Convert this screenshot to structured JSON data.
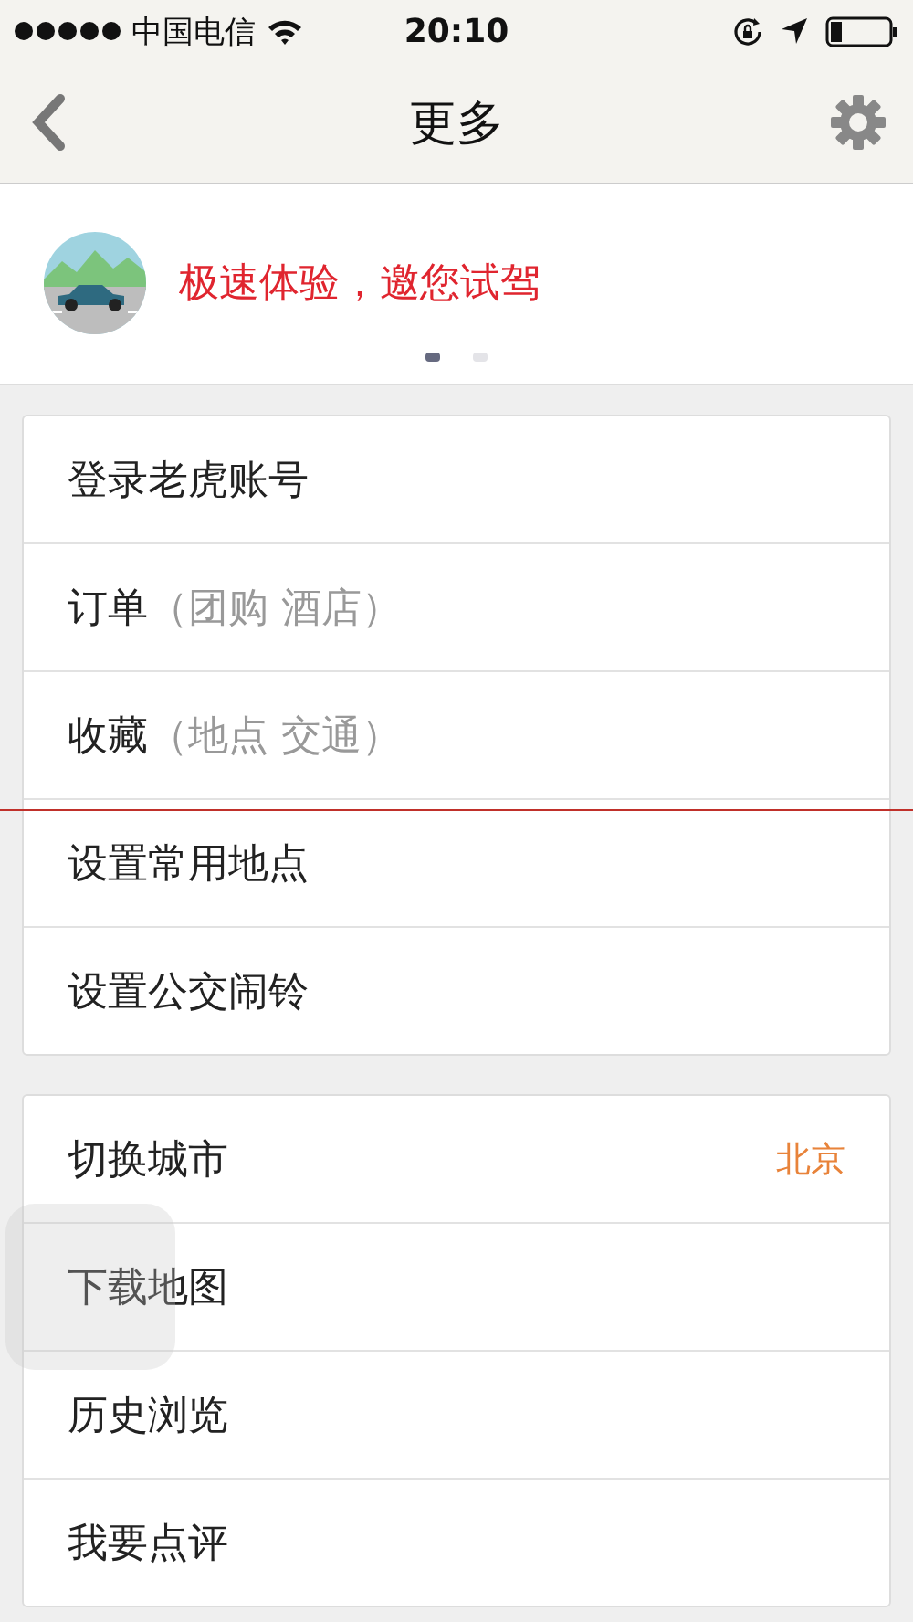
{
  "status_bar": {
    "carrier": "中国电信",
    "time": "20:10"
  },
  "nav": {
    "title": "更多"
  },
  "banner": {
    "text": "极速体验，邀您试驾",
    "pages": [
      {
        "selected": true
      },
      {
        "selected": false
      }
    ]
  },
  "groups": [
    {
      "rows": [
        {
          "label": "登录老虎账号"
        },
        {
          "label": "订单",
          "hint": "（团购 酒店）"
        },
        {
          "label": "收藏",
          "hint": "（地点 交通）"
        },
        {
          "label": "设置常用地点"
        },
        {
          "label": "设置公交闹铃"
        }
      ]
    },
    {
      "rows": [
        {
          "label": "切换城市",
          "value": "北京"
        },
        {
          "label": "下载地图"
        },
        {
          "label": "历史浏览"
        },
        {
          "label": "我要点评"
        }
      ]
    }
  ]
}
